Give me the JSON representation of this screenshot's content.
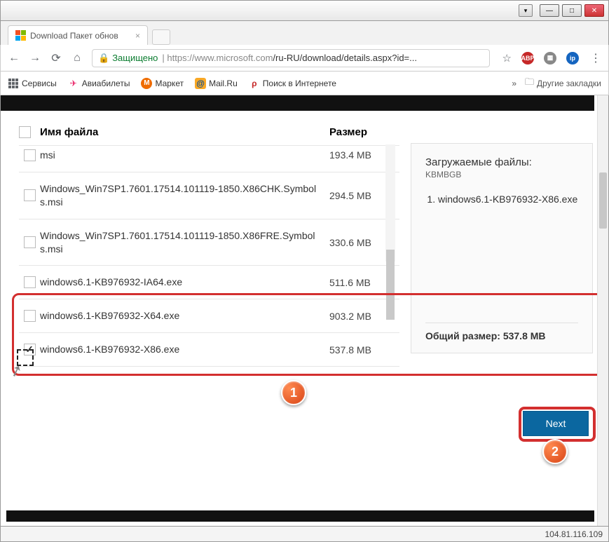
{
  "window": {
    "minimize": "—",
    "maximize": "□",
    "close": "✕",
    "glass": "▾"
  },
  "tab": {
    "title": "Download Пакет обнов",
    "close": "×"
  },
  "toolbar": {
    "secure_label": "Защищено",
    "url_host": "https://www.microsoft.com",
    "url_path": "/ru-RU/download/details.aspx?id=..."
  },
  "bookmarks": {
    "items": [
      {
        "label": "Сервисы"
      },
      {
        "label": "Авиабилеты"
      },
      {
        "label": "Маркет"
      },
      {
        "label": "Mail.Ru"
      },
      {
        "label": "Поиск в Интернете"
      }
    ],
    "more": "»",
    "other": "Другие закладки"
  },
  "table": {
    "col_name": "Имя файла",
    "col_size": "Размер",
    "rows": [
      {
        "name": "msi",
        "size": "193.4 MB",
        "checked": false
      },
      {
        "name": "Windows_Win7SP1.7601.17514.101119-1850.X86CHK.Symbols.msi",
        "size": "294.5 MB",
        "checked": false
      },
      {
        "name": "Windows_Win7SP1.7601.17514.101119-1850.X86FRE.Symbols.msi",
        "size": "330.6 MB",
        "checked": false
      },
      {
        "name": "windows6.1-KB976932-IA64.exe",
        "size": "511.6 MB",
        "checked": false
      },
      {
        "name": "windows6.1-KB976932-X64.exe",
        "size": "903.2 MB",
        "checked": false,
        "selected": true
      },
      {
        "name": "windows6.1-KB976932-X86.exe",
        "size": "537.8 MB",
        "checked": true
      }
    ]
  },
  "sidepanel": {
    "title": "Загружаемые файлы:",
    "subtitle": "KBMBGB",
    "list_item": "windows6.1-KB976932-X86.exe",
    "total_label": "Общий размер:",
    "total_value": "537.8 MB"
  },
  "next_button": "Next",
  "badges": {
    "one": "1",
    "two": "2"
  },
  "status_ip": "104.81.116.109"
}
